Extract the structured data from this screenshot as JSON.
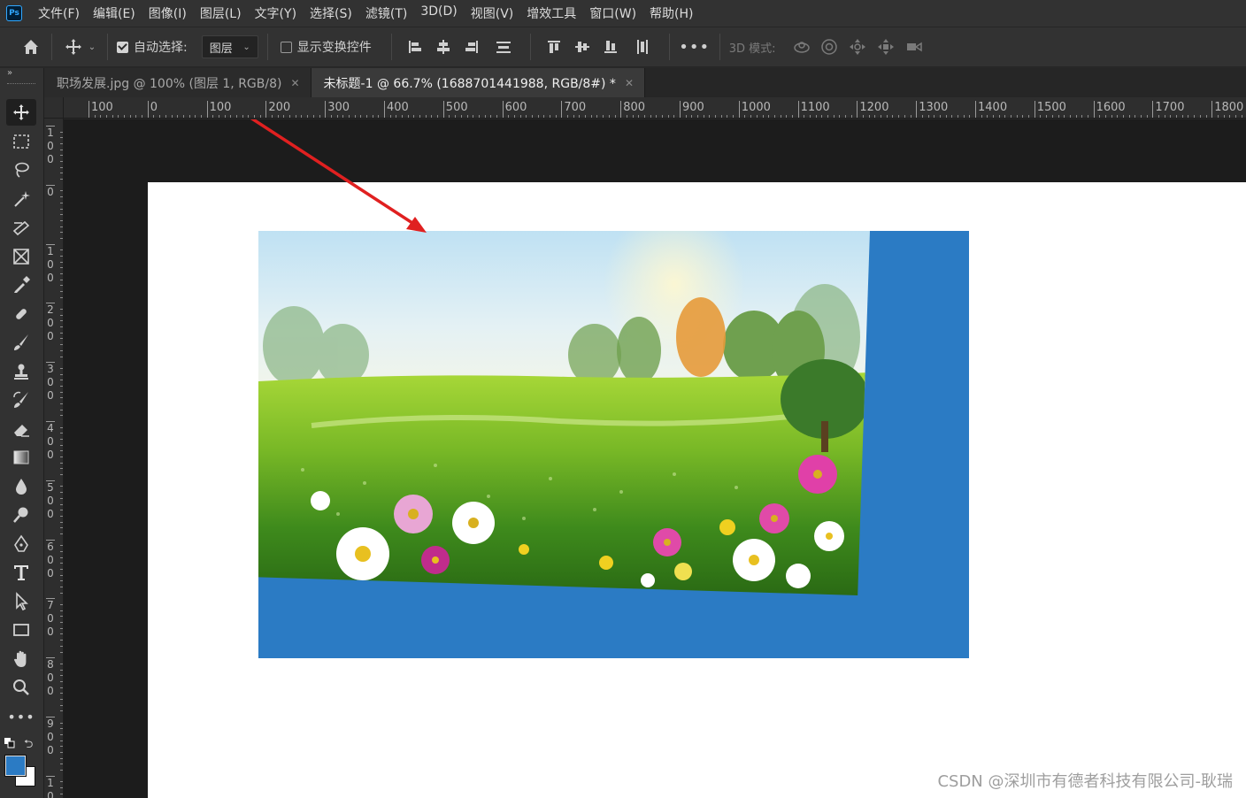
{
  "menu": {
    "logo": "Ps",
    "items": [
      "文件(F)",
      "编辑(E)",
      "图像(I)",
      "图层(L)",
      "文字(Y)",
      "选择(S)",
      "滤镜(T)",
      "3D(D)",
      "视图(V)",
      "增效工具",
      "窗口(W)",
      "帮助(H)"
    ]
  },
  "options": {
    "auto_select_label": "自动选择:",
    "auto_select_checked": true,
    "auto_select_target": "图层",
    "show_transform_label": "显示变换控件",
    "show_transform_checked": false,
    "mode3d_label": "3D 模式:"
  },
  "tabs": [
    {
      "label": "职场发展.jpg @ 100% (图层 1, RGB/8)",
      "active": false
    },
    {
      "label": "未标题-1 @ 66.7% (1688701441988, RGB/8#) *",
      "active": true
    }
  ],
  "ruler_top_labels": [
    "100",
    "0",
    "100",
    "200",
    "300",
    "400",
    "500",
    "600",
    "700",
    "800",
    "900",
    "1000",
    "1100",
    "1200",
    "1300",
    "1400",
    "1500",
    "1600",
    "1700",
    "1800"
  ],
  "ruler_left_labels": [
    "100",
    "0",
    "100",
    "200",
    "300",
    "400",
    "500",
    "600",
    "700",
    "800",
    "900",
    "10"
  ],
  "colors": {
    "foreground": "#2b7bc4",
    "background": "#ffffff",
    "annotation_arrow": "#e02020"
  },
  "watermark": "CSDN @深圳市有德者科技有限公司-耿瑞"
}
